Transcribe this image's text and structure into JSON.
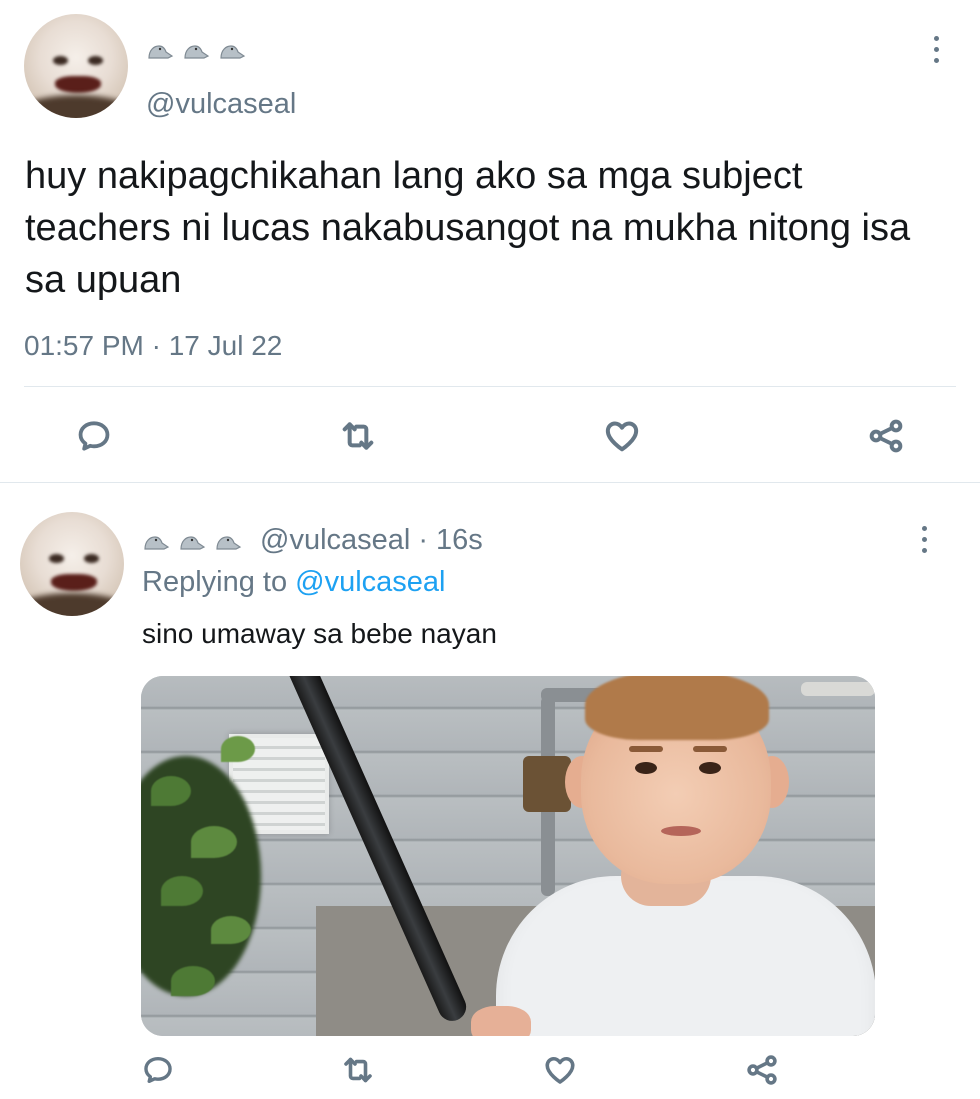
{
  "main_tweet": {
    "display_name_emoji": "🦭🦭🦭",
    "handle": "@vulcaseal",
    "text": "huy nakipagchikahan lang ako sa mga subject teachers ni lucas nakabusangot na mukha nitong isa sa upuan",
    "timestamp": "01:57 PM · 17 Jul 22",
    "actions": [
      "reply-icon",
      "retweet-icon",
      "like-icon",
      "share-icon"
    ]
  },
  "reply_tweet": {
    "display_name_emoji": "🦭🦭🦭",
    "handle": "@vulcaseal",
    "separator": "·",
    "age": "16s",
    "replying_prefix": "Replying to",
    "replying_mention": "@vulcaseal",
    "text": "sino umaway sa bebe nayan",
    "actions": [
      "reply-icon",
      "retweet-icon",
      "like-icon",
      "share-icon"
    ]
  },
  "colors": {
    "text_primary": "#14171a",
    "text_secondary": "#657786",
    "link": "#1da1f2",
    "divider": "#e1e8ed"
  }
}
